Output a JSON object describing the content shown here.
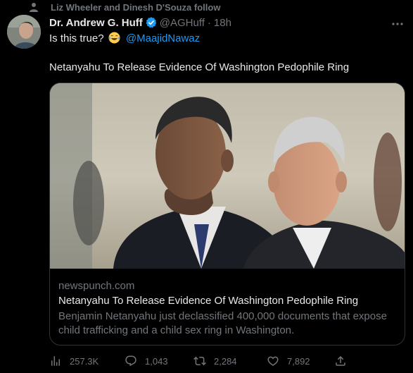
{
  "social_context": {
    "text": "Liz Wheeler and Dinesh D'Souza follow"
  },
  "author": {
    "display_name": "Dr. Andrew G. Huff",
    "handle": "@AGHuff",
    "separator": "·",
    "time": "18h"
  },
  "tweet": {
    "text_prefix": "Is this true?",
    "mention": "@MaajidNawaz",
    "headline": "Netanyahu To Release Evidence Of Washington Pedophile Ring"
  },
  "card": {
    "domain": "newspunch.com",
    "title": "Netanyahu To Release Evidence Of Washington Pedophile Ring",
    "description": "Benjamin Netanyahu just declassified 400,000 documents that expose child trafficking and a child sex ring in Washington."
  },
  "actions": {
    "views": "257.3K",
    "replies": "1,043",
    "retweets": "2,284",
    "likes": "7,892"
  },
  "colors": {
    "background": "#000000",
    "text": "#e7e9ea",
    "secondary": "#71767b",
    "accent": "#1d9bf0",
    "border": "#2f3336"
  },
  "icons": [
    "person-icon",
    "verified-icon",
    "more-icon",
    "emoji-joy-icon",
    "views-icon",
    "reply-icon",
    "retweet-icon",
    "like-icon",
    "share-icon"
  ]
}
